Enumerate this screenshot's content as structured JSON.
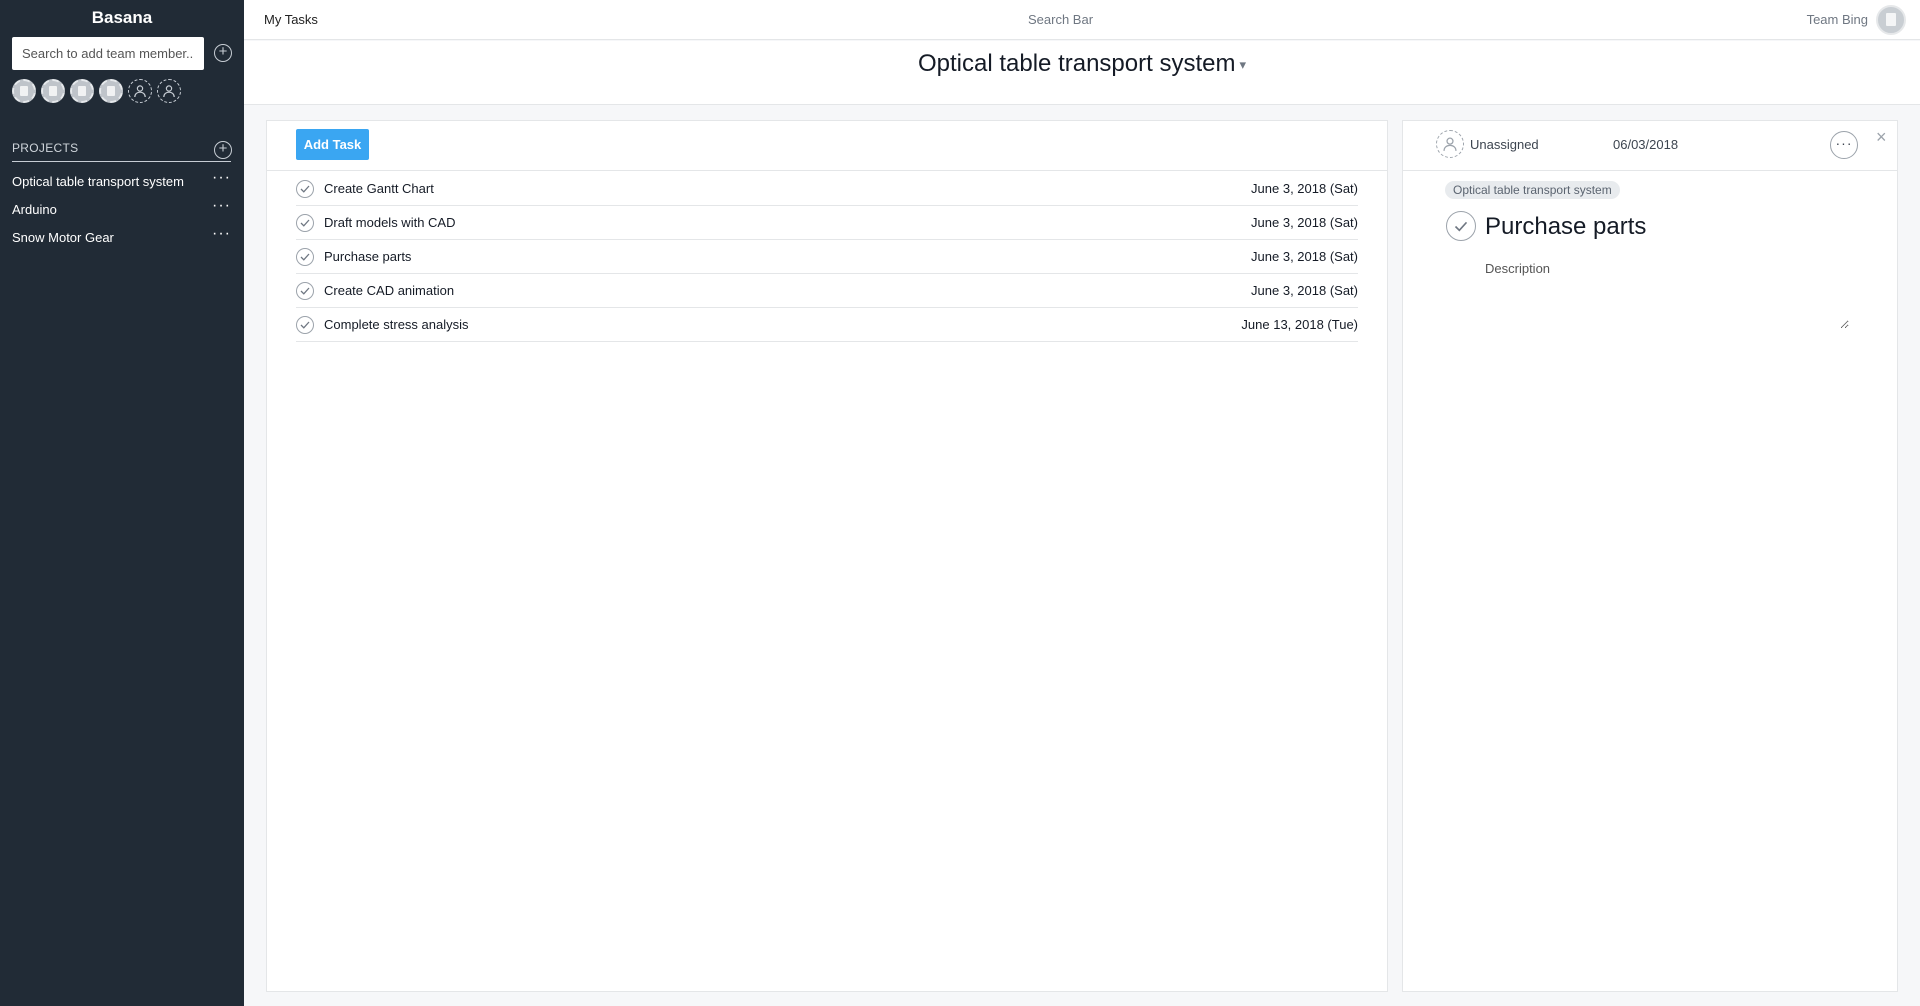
{
  "app": {
    "name": "Basana"
  },
  "sidebar": {
    "member_search_placeholder": "Search to add team member...",
    "members": [
      {
        "kind": "badge"
      },
      {
        "kind": "badge"
      },
      {
        "kind": "badge"
      },
      {
        "kind": "badge"
      },
      {
        "kind": "empty"
      },
      {
        "kind": "empty"
      }
    ],
    "projects_label": "PROJECTS",
    "projects": [
      {
        "name": "Optical table transport system",
        "more": "···"
      },
      {
        "name": "Arduino",
        "more": "···"
      },
      {
        "name": "Snow Motor Gear",
        "more": "···"
      }
    ]
  },
  "topbar": {
    "my_tasks": "My Tasks",
    "search": "Search Bar",
    "team": "Team Bing"
  },
  "project": {
    "title": "Optical table transport system",
    "caret": "▾"
  },
  "list": {
    "add_task_label": "Add Task",
    "tasks": [
      {
        "name": "Create Gantt Chart",
        "due": "June 3, 2018 (Sat)"
      },
      {
        "name": "Draft models with CAD",
        "due": "June 3, 2018 (Sat)"
      },
      {
        "name": "Purchase parts",
        "due": "June 3, 2018 (Sat)"
      },
      {
        "name": "Create CAD animation",
        "due": "June 3, 2018 (Sat)"
      },
      {
        "name": "Complete stress analysis",
        "due": "June 13, 2018 (Tue)"
      }
    ]
  },
  "detail": {
    "assignee": "Unassigned",
    "date": "06/03/2018",
    "more": "···",
    "close": "×",
    "project_tag": "Optical table transport system",
    "title": "Purchase parts",
    "description_placeholder": "Description"
  },
  "icons": {
    "plus": "plus-icon",
    "check": "check-icon",
    "user": "user-icon",
    "more": "ellipsis-icon",
    "close": "close-icon"
  },
  "colors": {
    "sidebar_bg": "#212b36",
    "accent": "#3aa6f2"
  }
}
